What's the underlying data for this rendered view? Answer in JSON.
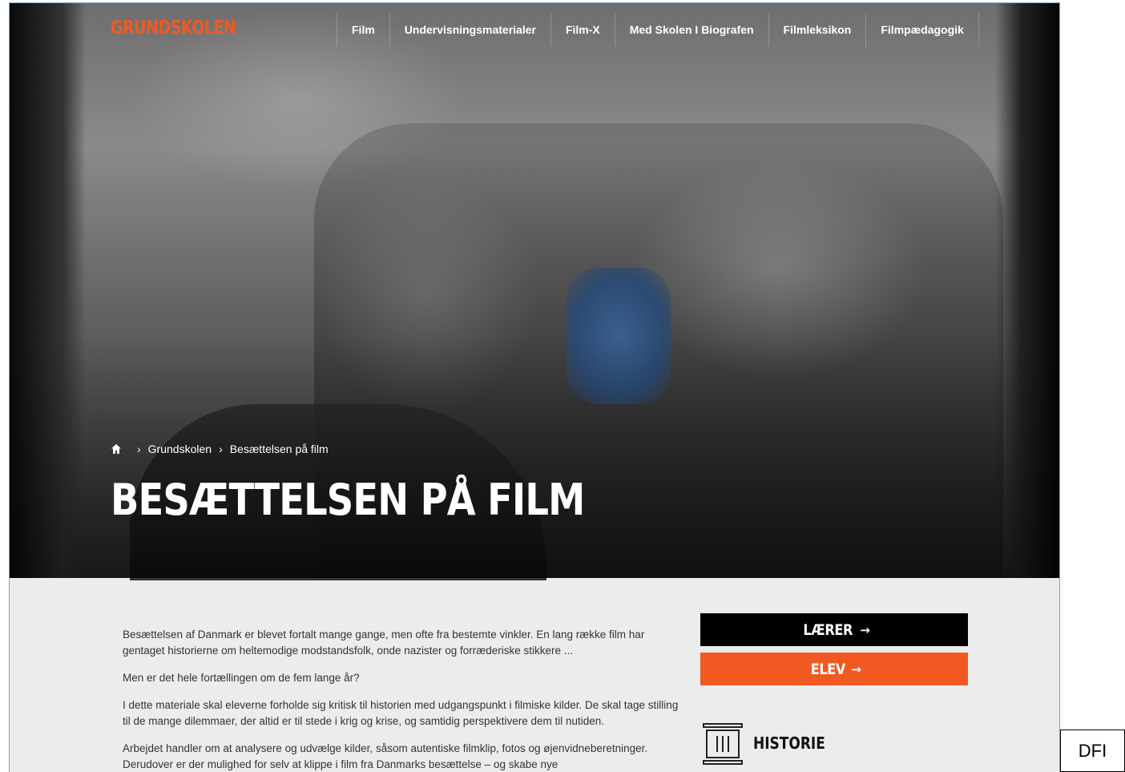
{
  "header": {
    "brand": "GRUNDSKOLEN",
    "nav": [
      "Film",
      "Undervisningsmaterialer",
      "Film-X",
      "Med Skolen I Biografen",
      "Filmleksikon",
      "Filmpædagogik"
    ]
  },
  "hero": {
    "breadcrumb": {
      "home_icon": "home-icon",
      "items": [
        "Grundskolen",
        "Besættelsen på film"
      ]
    },
    "title": "BESÆTTELSEN PÅ FILM"
  },
  "intro": {
    "paragraphs": [
      "Besættelsen af Danmark er blevet fortalt mange gange, men ofte fra bestemte vinkler. En lang række film har gentaget historierne om heltemodige modstandsfolk, onde nazister og forræderiske stikkere ...",
      "Men er det hele fortællingen om de fem lange år?",
      "I dette materiale skal eleverne forholde sig kritisk til historien med udgangspunkt i filmiske kilder. De skal tage stilling til de mange dilemmaer, der altid er til stede i krig og krise, og samtidig perspektivere dem til nutiden.",
      "Arbejdet handler om at analysere og udvælge kilder, såsom autentiske filmklip, fotos og øjenvidneberetninger. Derudover er der mulighed for selv at klippe i film fra Danmarks besættelse – og skabe nye"
    ]
  },
  "sidebar": {
    "teacher_button": "LÆRER",
    "student_button": "ELEV",
    "arrow": "→",
    "subject": {
      "icon": "column-icon",
      "label": "HISTORIE"
    }
  },
  "corner_label": "DFI",
  "colors": {
    "accent": "#f05a22",
    "dark_button": "#000000",
    "panel": "#ececec"
  }
}
